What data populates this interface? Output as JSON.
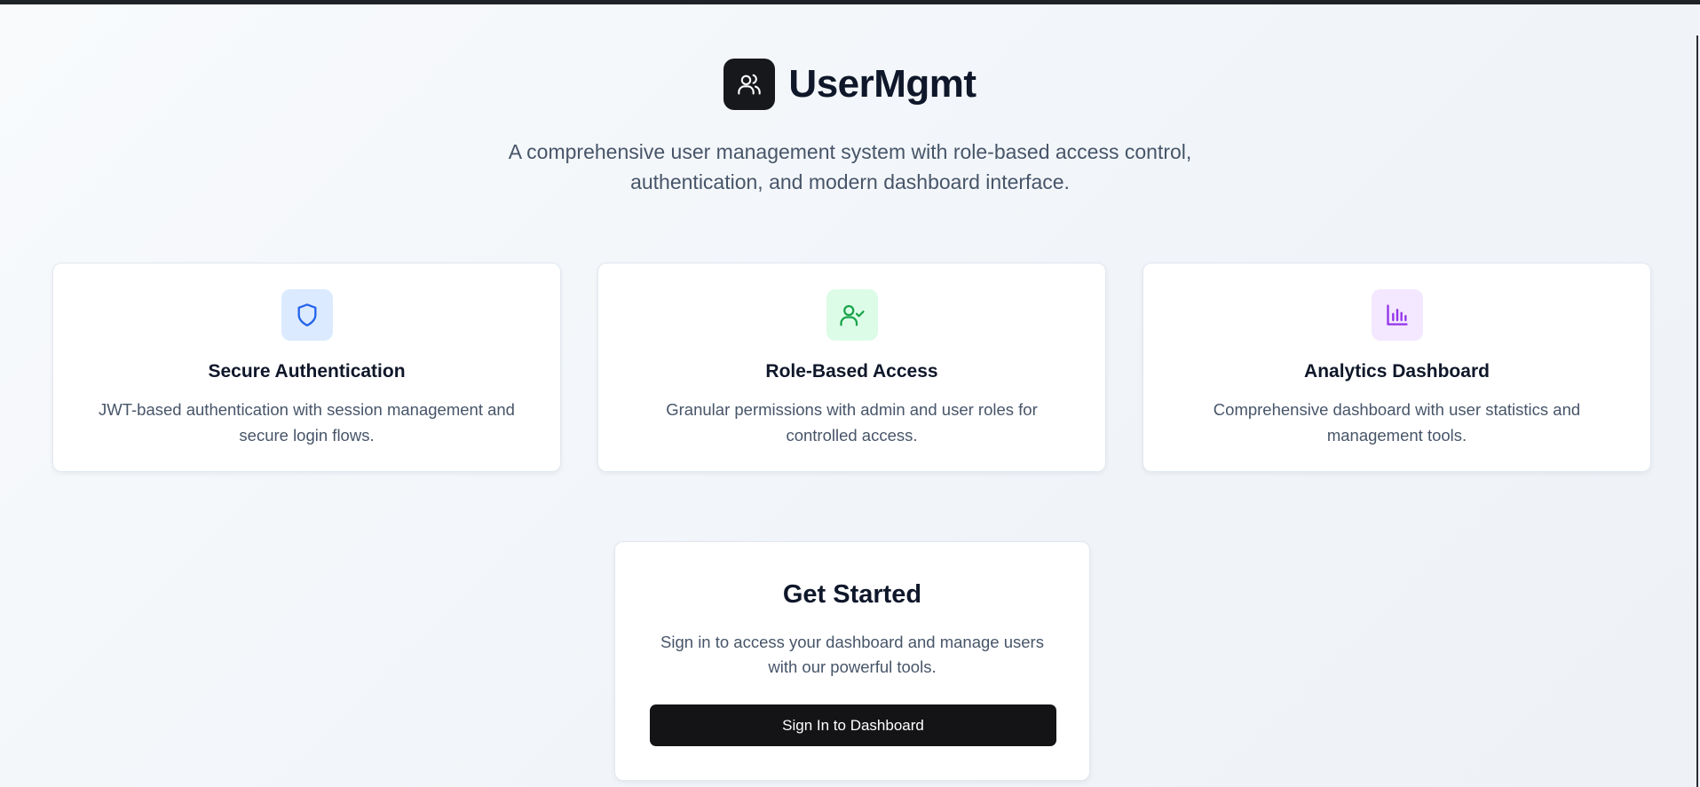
{
  "header": {
    "app_name": "UserMgmt",
    "logo_icon": "users-icon",
    "tagline": "A comprehensive user management system with role-based access control, authentication, and modern dashboard interface."
  },
  "features": [
    {
      "title": "Secure Authentication",
      "description": "JWT-based authentication with session management and secure login flows.",
      "icon": "shield-icon",
      "icon_bg": "#dbeafe",
      "icon_color": "#2563eb"
    },
    {
      "title": "Role-Based Access",
      "description": "Granular permissions with admin and user roles for controlled access.",
      "icon": "user-check-icon",
      "icon_bg": "#dcfce7",
      "icon_color": "#16a34a"
    },
    {
      "title": "Analytics Dashboard",
      "description": "Comprehensive dashboard with user statistics and management tools.",
      "icon": "bar-chart-icon",
      "icon_bg": "#f3e8ff",
      "icon_color": "#9333ea"
    }
  ],
  "cta": {
    "title": "Get Started",
    "description": "Sign in to access your dashboard and manage users with our powerful tools.",
    "button_label": "Sign In to Dashboard"
  },
  "colors": {
    "primary_dark": "#141416",
    "text_primary": "#0f172a",
    "text_secondary": "#475569"
  }
}
